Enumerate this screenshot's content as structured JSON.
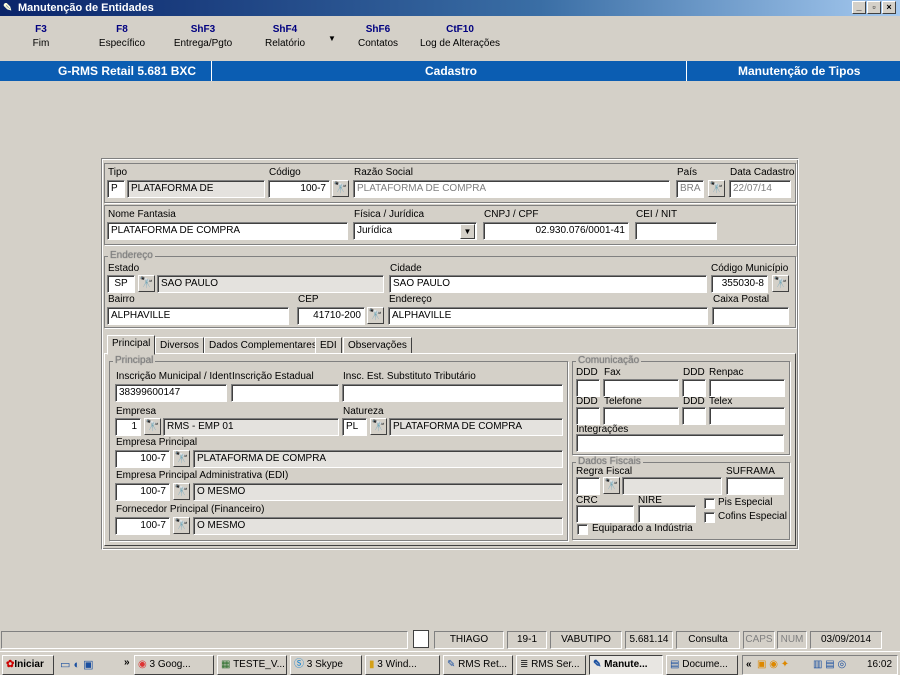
{
  "window": {
    "title": "Manutenção de Entidades",
    "min": "_",
    "max": "▫",
    "close": "×"
  },
  "fkeys": [
    {
      "key": "F3",
      "label": "Fim"
    },
    {
      "key": "F8",
      "label": "Específico"
    },
    {
      "key": "ShF3",
      "label": "Entrega/Pgto"
    },
    {
      "key": "ShF4",
      "label": "Relatório"
    },
    {
      "key": "ShF6",
      "label": "Contatos"
    },
    {
      "key": "CtF10",
      "label": "Log de Alterações"
    }
  ],
  "banner": {
    "left": "G-RMS Retail 5.681 BXC",
    "center": "Cadastro",
    "right": "Manutenção de Tipos"
  },
  "form": {
    "tipo_label": "Tipo",
    "tipo_code": "P",
    "tipo_desc": "PLATAFORMA DE",
    "codigo_label": "Código",
    "codigo": "100-7",
    "razao_label": "Razão Social",
    "razao": "PLATAFORMA DE COMPRA",
    "pais_label": "País",
    "pais": "BRA",
    "data_label": "Data Cadastro",
    "data": "22/07/14",
    "fantasia_label": "Nome Fantasia",
    "fantasia": "PLATAFORMA DE COMPRA",
    "fisjur_label": "Física / Jurídica",
    "fisjur": "Jurídica",
    "cnpj_label": "CNPJ / CPF",
    "cnpj": "02.930.076/0001-41",
    "cei_label": "CEI / NIT",
    "cei": "",
    "endereco_group": "Endereço",
    "estado_label": "Estado",
    "estado": "SP",
    "estado_nome": "SAO PAULO",
    "cidade_label": "Cidade",
    "cidade": "SAO PAULO",
    "codmun_label": "Código Município",
    "codmun": "355030-8",
    "bairro_label": "Bairro",
    "bairro": "ALPHAVILLE",
    "cep_label": "CEP",
    "cep": "41710-200",
    "endereco_label": "Endereço",
    "endereco": "ALPHAVILLE",
    "caixa_label": "Caixa Postal",
    "caixa": ""
  },
  "tabs": [
    "Principal",
    "Diversos",
    "Dados Complementares",
    "EDI",
    "Observações"
  ],
  "principal": {
    "group": "Principal",
    "inscmun_label": "Inscrição Municipal / Ident",
    "inscmun": "38399600147",
    "inscest_label": "Inscrição Estadual",
    "inscest": "",
    "inscsub_label": "Insc. Est. Substituto Tributário",
    "inscsub": "",
    "empresa_label": "Empresa",
    "empresa": "1",
    "empresa_nome": "RMS - EMP 01",
    "natureza_label": "Natureza",
    "natureza": "PL",
    "natureza_nome": "PLATAFORMA DE COMPRA",
    "emp_princ_label": "Empresa Principal",
    "emp_princ": "100-7",
    "emp_princ_nome": "PLATAFORMA DE COMPRA",
    "emp_adm_label": "Empresa Principal Administrativa (EDI)",
    "emp_adm": "100-7",
    "emp_adm_nome": "O MESMO",
    "forn_label": "Fornecedor Principal (Financeiro)",
    "forn": "100-7",
    "forn_nome": "O MESMO"
  },
  "comunicacao": {
    "group": "Comunicação",
    "ddd": "DDD",
    "fax": "Fax",
    "renpac": "Renpac",
    "telefone": "Telefone",
    "telex": "Telex",
    "integracoes": "Integrações"
  },
  "fiscais": {
    "group": "Dados Fiscais",
    "regra": "Regra Fiscal",
    "suframa": "SUFRAMA",
    "crc": "CRC",
    "nire": "NIRE",
    "pis": "Pis Especial",
    "cofins": "Cofins Especial",
    "equiparado": "Equiparado a Indústria"
  },
  "status": {
    "user": "THIAGO",
    "code": "19-1",
    "prog": "VABUTIPO",
    "version": "5.681.14",
    "mode": "Consulta",
    "caps": "CAPS",
    "num": "NUM",
    "date": "03/09/2014"
  },
  "taskbar": {
    "start": "Iniciar",
    "items": [
      "3 Goog...",
      "TESTE_V...",
      "3 Skype",
      "3 Wind...",
      "RMS Ret...",
      "RMS Ser...",
      "Manute...",
      "Docume..."
    ],
    "time": "16:02"
  }
}
